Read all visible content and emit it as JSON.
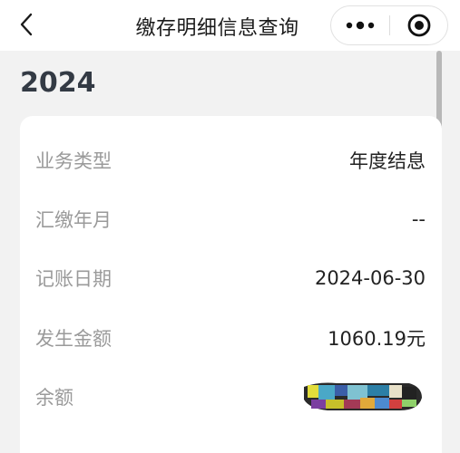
{
  "header": {
    "title": "缴存明细信息查询",
    "back_icon": "chevron-left-icon",
    "more_icon": "more-dots-icon",
    "close_icon": "target-close-icon"
  },
  "section": {
    "year": "2024"
  },
  "details": [
    {
      "label": "业务类型",
      "value": "年度结息"
    },
    {
      "label": "汇缴年月",
      "value": "--"
    },
    {
      "label": "记账日期",
      "value": "2024-06-30"
    },
    {
      "label": "发生金额",
      "value": "1060.19元"
    },
    {
      "label": "余额",
      "value": ""
    }
  ],
  "colors": {
    "background": "#f2f2f2",
    "card": "#ffffff",
    "label_gray": "#9a9a9a",
    "year_text": "#333a44"
  }
}
